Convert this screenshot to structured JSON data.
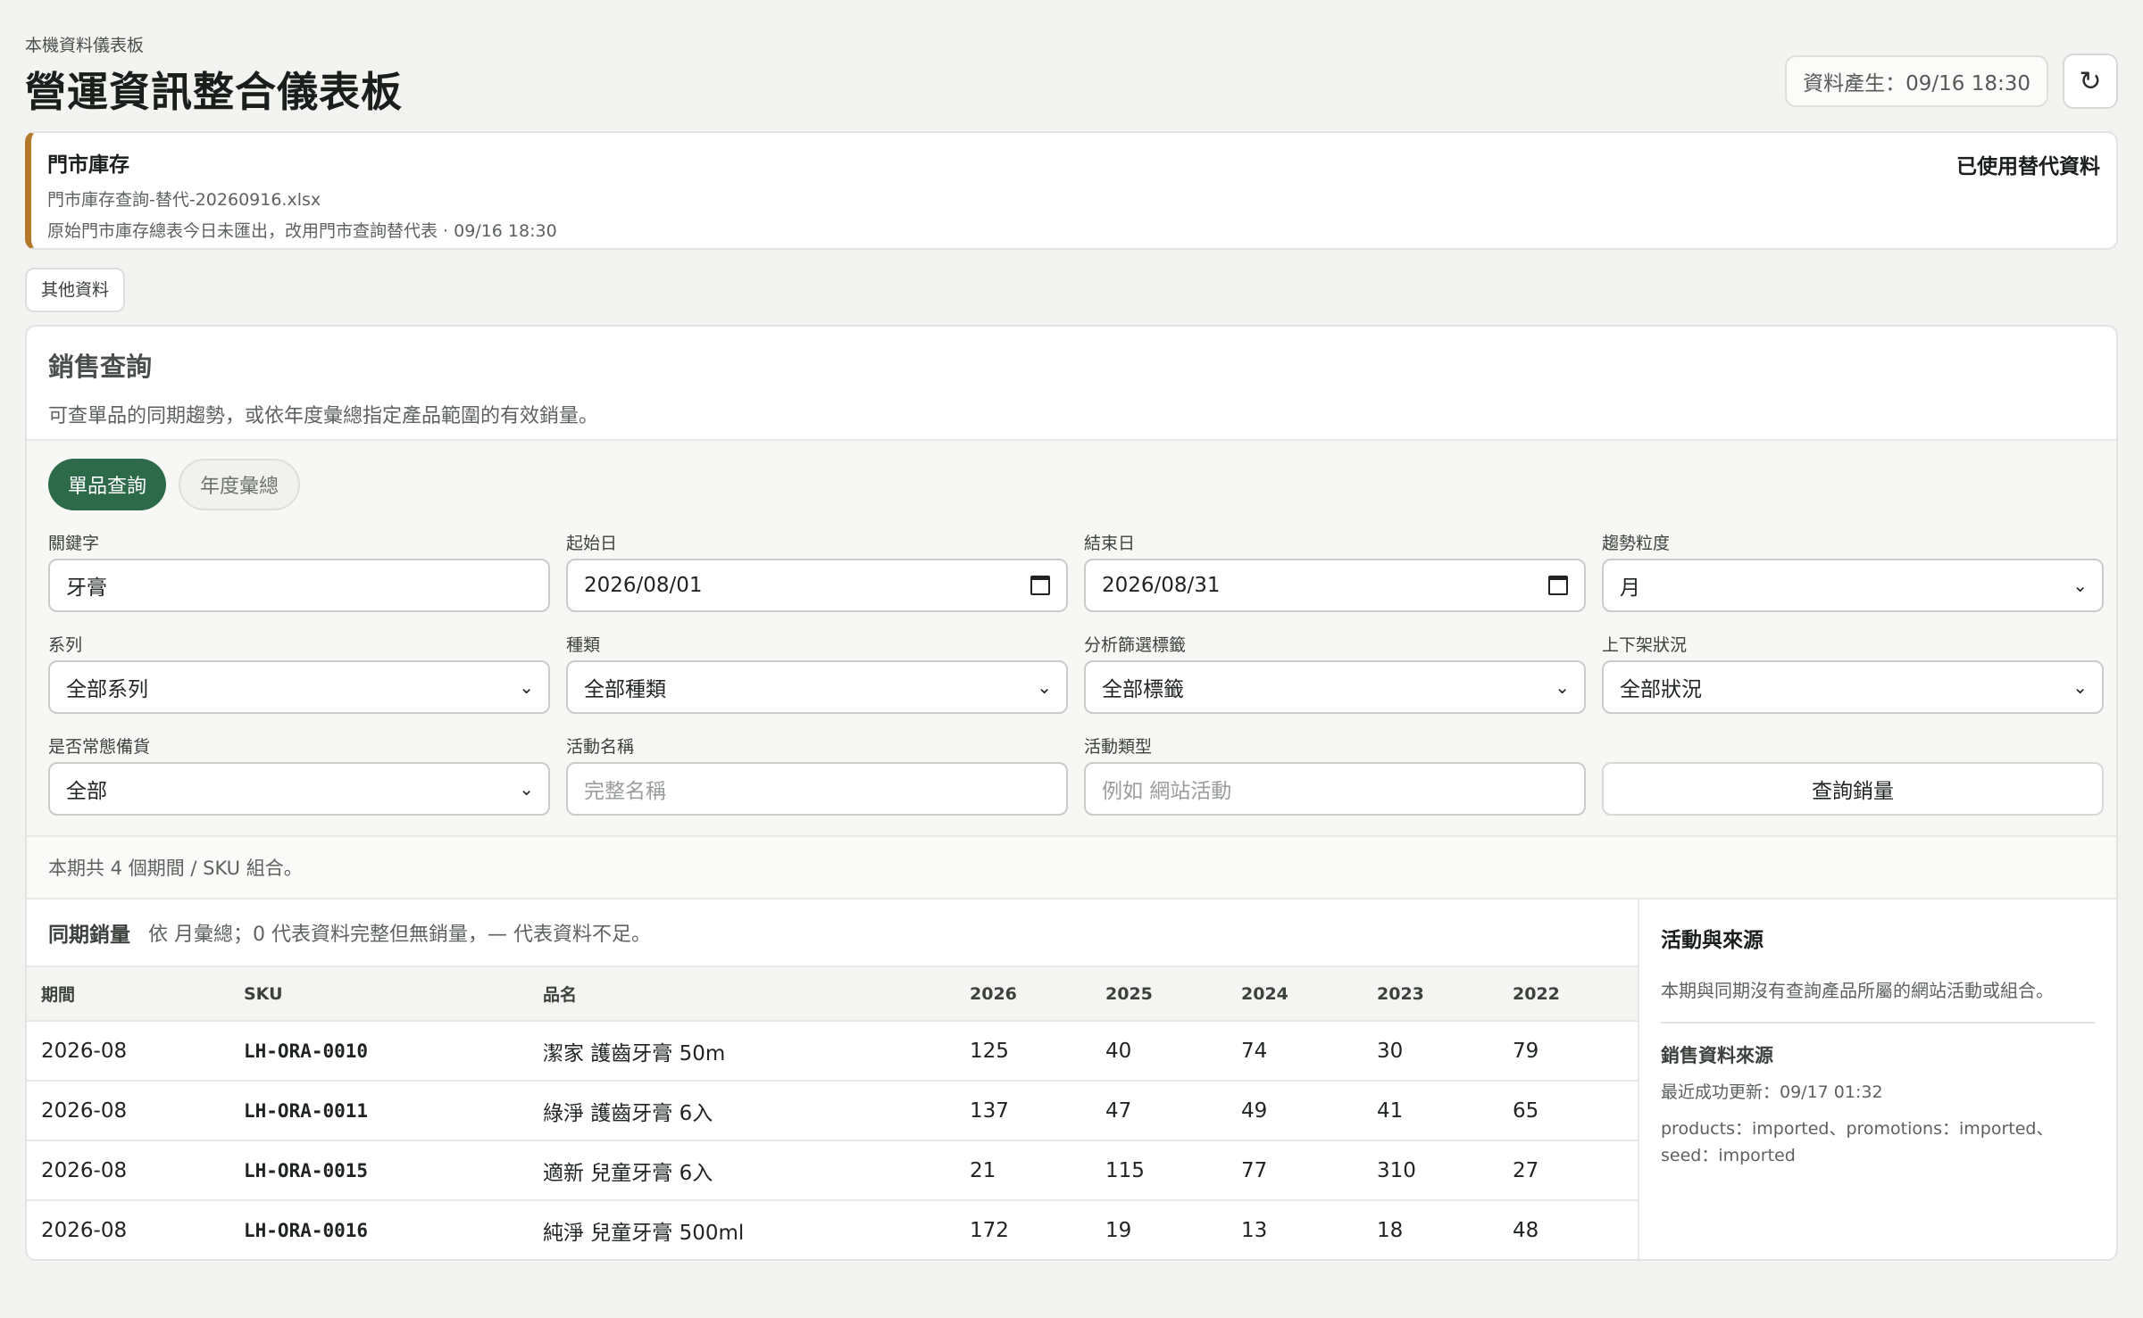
{
  "header": {
    "eyebrow": "本機資料儀表板",
    "title": "營運資訊整合儀表板",
    "generated": "資料產生：09/16 18:30",
    "refresh_symbol": "↻"
  },
  "inventory_notice": {
    "title": "門市庫存",
    "file": "門市庫存查詢-替代-20260916.xlsx",
    "description": "原始門市庫存總表今日未匯出，改用門市查詢替代表 · 09/16 18:30",
    "status": "已使用替代資料",
    "accent_color": "#b3782a"
  },
  "other_data_button": "其他資料",
  "sales": {
    "title": "銷售查詢",
    "subtitle": "可查單品的同期趨勢，或依年度彙總指定產品範圍的有效銷量。",
    "tabs": [
      {
        "label": "單品查詢",
        "active": true
      },
      {
        "label": "年度彙總",
        "active": false
      }
    ],
    "filters": {
      "keyword": {
        "label": "關鍵字",
        "value": "牙膏"
      },
      "start_date": {
        "label": "起始日",
        "value": "2026/08/01"
      },
      "end_date": {
        "label": "結束日",
        "value": "2026/08/31"
      },
      "granularity": {
        "label": "趨勢粒度",
        "value": "月"
      },
      "series": {
        "label": "系列",
        "value": "全部系列"
      },
      "category": {
        "label": "種類",
        "value": "全部種類"
      },
      "tag": {
        "label": "分析篩選標籤",
        "value": "全部標籤"
      },
      "shelf_status": {
        "label": "上下架狀況",
        "value": "全部狀況"
      },
      "regular_stock": {
        "label": "是否常態備貨",
        "value": "全部"
      },
      "campaign_name": {
        "label": "活動名稱",
        "placeholder": "完整名稱"
      },
      "campaign_type": {
        "label": "活動類型",
        "placeholder": "例如 網站活動"
      },
      "query_button": "查詢銷量"
    },
    "result_count": "本期共 4 個期間 / SKU 組合。",
    "table": {
      "title": "同期銷量",
      "note": "依 月彙總；0 代表資料完整但無銷量，— 代表資料不足。",
      "columns": [
        "期間",
        "SKU",
        "品名",
        "2026",
        "2025",
        "2024",
        "2023",
        "2022"
      ],
      "rows": [
        [
          "2026-08",
          "LH-ORA-0010",
          "潔家 護齒牙膏 50m",
          "125",
          "40",
          "74",
          "30",
          "79"
        ],
        [
          "2026-08",
          "LH-ORA-0011",
          "綠淨 護齒牙膏 6入",
          "137",
          "47",
          "49",
          "41",
          "65"
        ],
        [
          "2026-08",
          "LH-ORA-0015",
          "適新 兒童牙膏 6入",
          "21",
          "115",
          "77",
          "310",
          "27"
        ],
        [
          "2026-08",
          "LH-ORA-0016",
          "純淨 兒童牙膏 500ml",
          "172",
          "19",
          "13",
          "18",
          "48"
        ]
      ]
    },
    "side": {
      "title": "活動與來源",
      "text": "本期與同期沒有查詢產品所屬的網站活動或組合。",
      "source_title": "銷售資料來源",
      "source_time": "最近成功更新：09/17 01:32",
      "source_detail": "products：imported、promotions：imported、seed：imported"
    },
    "accent_color": "#2d6a4a"
  }
}
